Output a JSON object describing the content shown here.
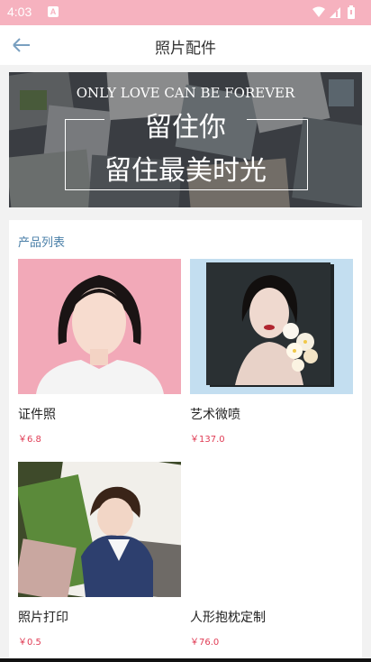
{
  "status": {
    "time": "4:03",
    "app_badge": "A"
  },
  "nav": {
    "title": "照片配件"
  },
  "banner": {
    "en_text": "ONLY LOVE CAN BE FOREVER",
    "line1": "留住你",
    "line2": "留住最美时光"
  },
  "products": {
    "title": "产品列表",
    "items": [
      {
        "name": "证件照",
        "price": "￥6.8"
      },
      {
        "name": "艺术微喷",
        "price": "￥137.0"
      },
      {
        "name": "照片打印",
        "price": "￥0.5"
      },
      {
        "name": "人形抱枕定制",
        "price": "￥76.0"
      }
    ]
  },
  "colors": {
    "status_bar": "#f6b2bf",
    "accent_title": "#4a7fa8",
    "price": "#e03c55"
  }
}
